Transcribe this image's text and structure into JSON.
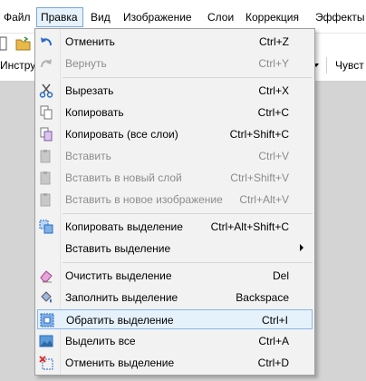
{
  "menubar": {
    "items": [
      "Файл",
      "Правка",
      "Вид",
      "Изображение",
      "Слои",
      "Коррекция",
      "Эффекты"
    ]
  },
  "toolbar": {
    "left_text": "Инстру",
    "right_text": "Чувст"
  },
  "menu": {
    "items": [
      {
        "label": "Отменить",
        "shortcut": "Ctrl+Z",
        "icon": "undo-icon",
        "disabled": false
      },
      {
        "label": "Вернуть",
        "shortcut": "Ctrl+Y",
        "icon": "redo-icon",
        "disabled": true
      },
      {
        "label": "Вырезать",
        "shortcut": "Ctrl+X",
        "icon": "scissors-icon",
        "disabled": false
      },
      {
        "label": "Копировать",
        "shortcut": "Ctrl+C",
        "icon": "copy-icon",
        "disabled": false
      },
      {
        "label": "Копировать (все слои)",
        "shortcut": "Ctrl+Shift+C",
        "icon": "copy-merged-icon",
        "disabled": false
      },
      {
        "label": "Вставить",
        "shortcut": "Ctrl+V",
        "icon": "paste-icon",
        "disabled": true
      },
      {
        "label": "Вставить в новый слой",
        "shortcut": "Ctrl+Shift+V",
        "icon": "paste-layer-icon",
        "disabled": true
      },
      {
        "label": "Вставить в новое изображение",
        "shortcut": "Ctrl+Alt+V",
        "icon": "paste-image-icon",
        "disabled": true
      },
      {
        "label": "Копировать выделение",
        "shortcut": "Ctrl+Alt+Shift+C",
        "icon": "copy-selection-icon",
        "disabled": false
      },
      {
        "label": "Вставить выделение",
        "shortcut": "",
        "icon": "",
        "disabled": false,
        "submenu": true
      },
      {
        "label": "Очистить выделение",
        "shortcut": "Del",
        "icon": "eraser-icon",
        "disabled": false
      },
      {
        "label": "Заполнить выделение",
        "shortcut": "Backspace",
        "icon": "fill-icon",
        "disabled": false
      },
      {
        "label": "Обратить выделение",
        "shortcut": "Ctrl+I",
        "icon": "invert-selection-icon",
        "disabled": false,
        "highlighted": true
      },
      {
        "label": "Выделить все",
        "shortcut": "Ctrl+A",
        "icon": "select-all-icon",
        "disabled": false
      },
      {
        "label": "Отменить выделение",
        "shortcut": "Ctrl+D",
        "icon": "deselect-icon",
        "disabled": false
      }
    ]
  },
  "colors": {
    "highlight_bg": "#e5f1fb",
    "highlight_border": "#8ab8e8",
    "disabled_text": "#8c8c8c",
    "accent_blue": "#2b6cc4"
  }
}
